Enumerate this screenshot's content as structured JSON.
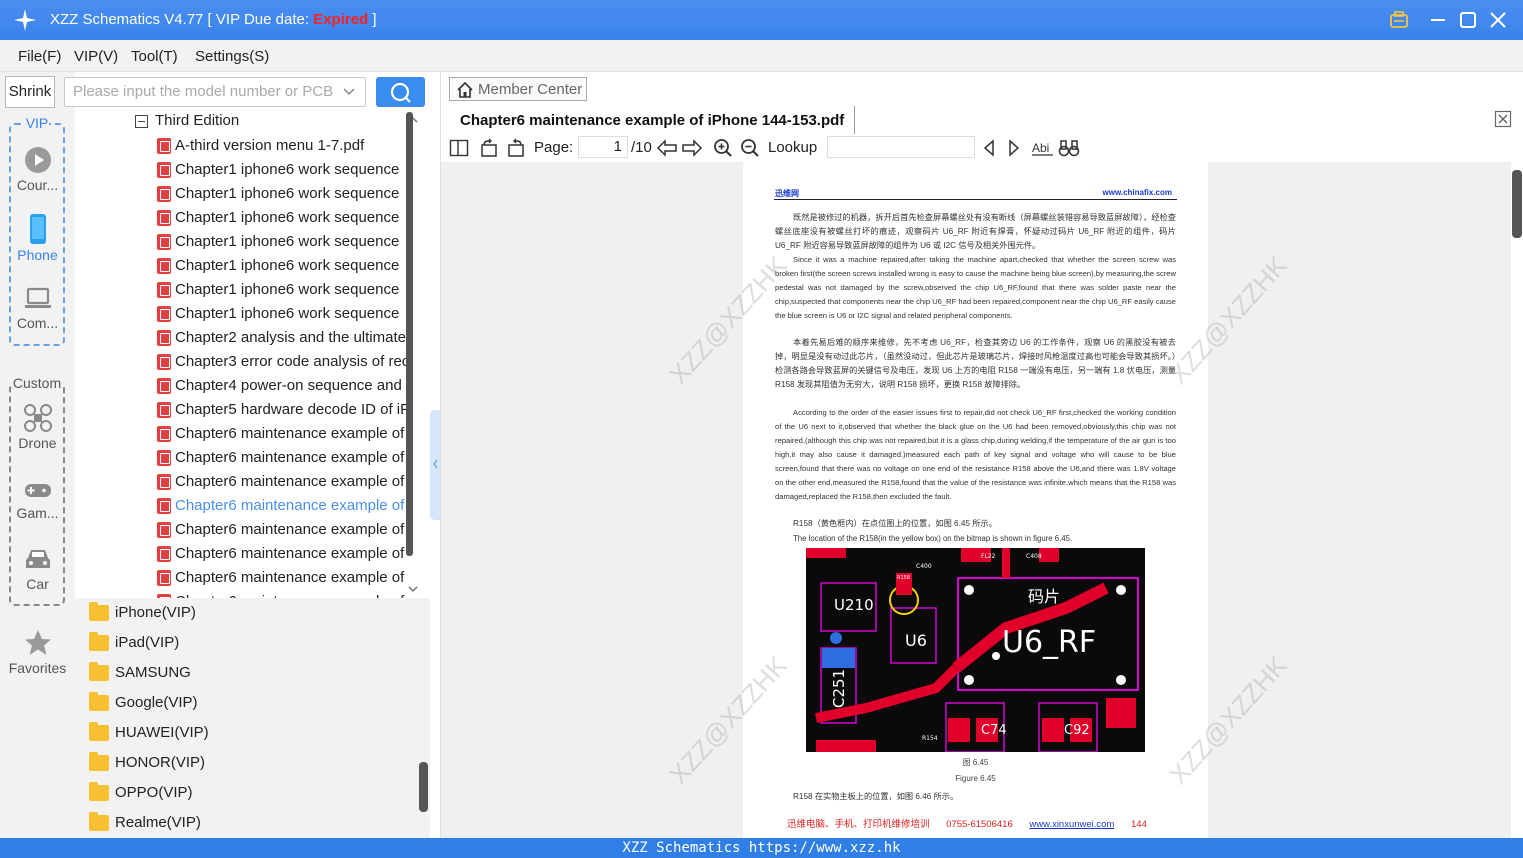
{
  "titlebar": {
    "app": "XZZ Schematics V4.77 [ VIP Due date:",
    "status": "Expired",
    "close_bracket": "]"
  },
  "menu": [
    "File(F)",
    "VIP(V)",
    "Tool(T)",
    "Settings(S)"
  ],
  "rail": {
    "shrink_label": "Shrink",
    "vip_legend": "VIP",
    "vip_items": [
      {
        "label": "Cour...",
        "icon": "play-circle-icon"
      },
      {
        "label": "Phone",
        "icon": "phone-icon",
        "active": true
      },
      {
        "label": "Com...",
        "icon": "laptop-icon"
      }
    ],
    "custom_legend": "Custom",
    "custom_items": [
      {
        "label": "Drone",
        "icon": "drone-icon"
      },
      {
        "label": "Gam...",
        "icon": "gamepad-icon"
      },
      {
        "label": "Car",
        "icon": "car-icon"
      }
    ],
    "favorites_label": "Favorites"
  },
  "search": {
    "placeholder": "Please input the model number or PCB"
  },
  "tree": {
    "group": "Third Edition",
    "items": [
      "A-third version menu  1-7.pdf",
      "Chapter1 iphone6 work sequence",
      "Chapter1 iphone6 work sequence",
      "Chapter1 iphone6 work sequence",
      "Chapter1 iphone6 work sequence",
      "Chapter1 iphone6 work sequence",
      "Chapter1 iphone6 work sequence",
      "Chapter1 iphone6 work sequence",
      "Chapter2 analysis and the ultimate",
      "Chapter3 error code analysis of rec",
      "Chapter4 power-on sequence and",
      "Chapter5 hardware decode ID of iP",
      "Chapter6 maintenance example of",
      "Chapter6 maintenance example of",
      "Chapter6 maintenance example of",
      "Chapter6 maintenance example of",
      "Chapter6 maintenance example of",
      "Chapter6 maintenance example of",
      "Chapter6 maintenance example of",
      "Chapter6 maintenance example of"
    ],
    "selected_index": 15
  },
  "brands": [
    "iPhone(VIP)",
    "iPad(VIP)",
    "SAMSUNG",
    "Google(VIP)",
    "HUAWEI(VIP)",
    "HONOR(VIP)",
    "OPPO(VIP)",
    "Realme(VIP)"
  ],
  "viewer": {
    "member_center": "Member Center",
    "doc_title": "Chapter6 maintenance example of iPhone 144-153.pdf",
    "page_label": "Page:",
    "page_current": "1",
    "page_total": "/10",
    "lookup_label": "Lookup"
  },
  "pdf": {
    "header_left": "迅维网",
    "header_right": "www.chinafix.com",
    "para1_cn": "既然是被修过的机器，拆开后首先检查屏幕螺丝处有没有断线（屏幕螺丝装错容易导致蓝屏故障），经检查螺丝底座没有被螺丝打坏的痕迹，观察码片 U6_RF 附近有焊膏，怀疑动过码片 U6_RF 附近的组件，码片 U6_RF 附近容易导致蓝屏故障的组件为 U6 或 I2C 信号及相关外围元件。",
    "para1_en": "Since it was a machine repaired,after taking the machine apart,checked that whether the screen screw was broken first(the screen screws installed wrong is easy to cause the machine being blue screen),by measuring,the screw pedestal was not damaged by the screw,observed the chip U6_RF,found that there was solder paste near the chip,suspected that components near the chip U6_RF had been repaired,component near the chip U6_RF easily cause the blue screen is U6 or I2C signal and related peripheral components.",
    "para2_cn": "本着先易后难的顺序来维修，先不考虑 U6_RF，检查其旁边 U6 的工作条件，观察 U6 的黑胶没有被去掉，明显是没有动过此芯片，（虽然没动过，但此芯片是玻璃芯片，焊接时风枪温度过高也可能会导致其损坏。）检测各路会导致蓝屏的关键信号及电压，发现 U6 上方的电阻 R158 一端没有电压，另一端有 1.8 伏电压，测量 R158 发现其阻值为无穷大，说明 R158 损坏，更换 R158 故障排除。",
    "para2_en": "According to the order of the easier issues first to repair,did not check U6_RF first,checked the working condition of the U6 next to it,observed that whether the black glue on the U6 had been removed,obviously,this chip was not repaired,(although this chip was not repaired,but it is a glass chip,during welding,if the temperature of the air gun is too high,it may also cause it damaged.)measured each path of key signal and voltage who will cause to be blue screen,found that there was no voltage on one end of the resistance R158 above the U6,and there was 1.8V voltage on the other end,measured the R158,found that the value of the resistance was infinite,which means that the R158 was damaged,replaced the R158,then excluded the fault.",
    "loc_cn": "R158（黄色框内）在点位图上的位置，如图 6.45 所示。",
    "loc_en": "The location of the R158(in the yellow box) on the bitmap is shown in figure 6.45.",
    "fig_labels": [
      "U210",
      "U6",
      "码片",
      "U6_RF",
      "C251",
      "C74",
      "C92",
      "R158",
      "FL22",
      "C408",
      "C400",
      "R154"
    ],
    "fig_caption_cn": "图 6.45",
    "fig_caption_en": "Figure 6.45",
    "after_fig": "R158 在实物主板上的位置，如图 6.46 所示。",
    "footer_left": "迅维电脑、手机、打印机维修培训",
    "footer_phone": "0755-61506416",
    "footer_link": "www.xinxunwei.com",
    "footer_page": "144"
  },
  "watermark": "XZZ@XZZHK",
  "statusbar": "XZZ Schematics https://www.xzz.hk",
  "colors": {
    "accent": "#3a82ec",
    "expired": "#ff2020",
    "selected": "#4a90e8"
  }
}
